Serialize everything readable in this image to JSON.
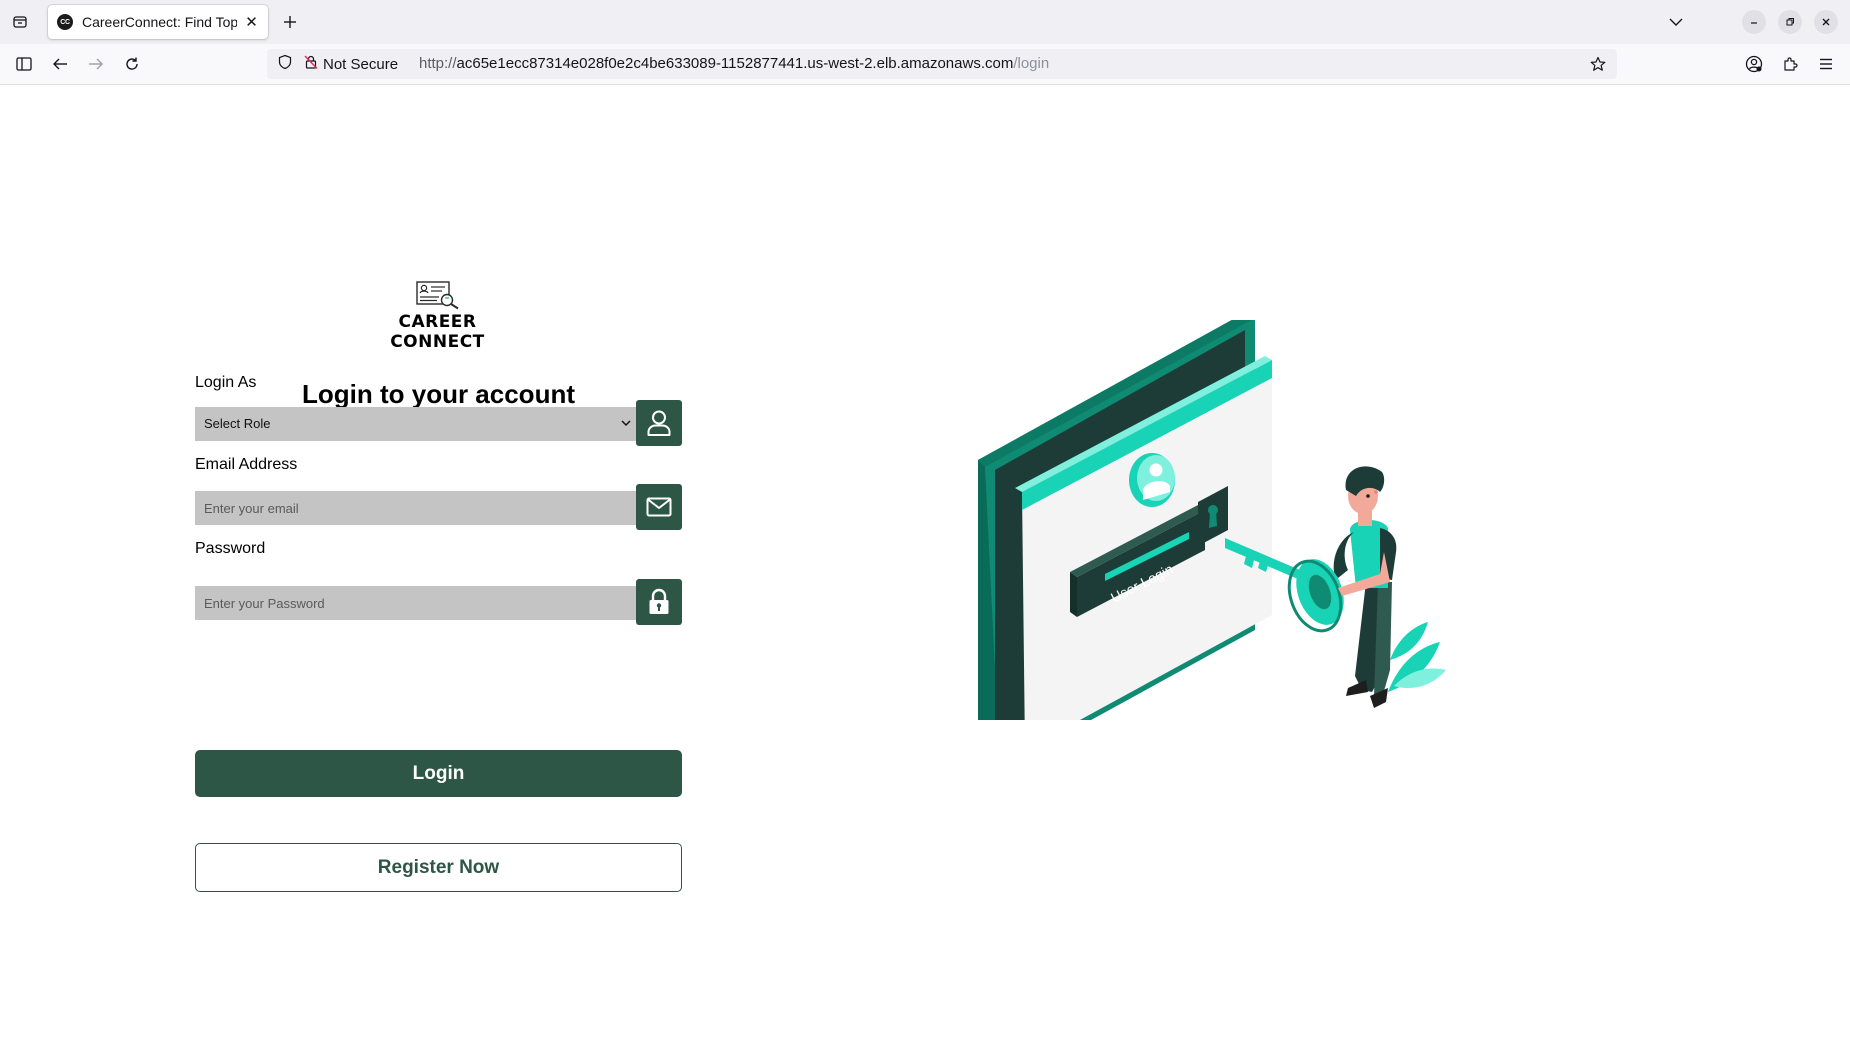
{
  "browser": {
    "tab": {
      "favicon_text": "CC",
      "title": "CareerConnect: Find Top"
    },
    "security_label": "Not Secure",
    "url": {
      "scheme": "http://",
      "host": "ac65e1ecc87314e028f0e2c4be633089-1152877441.us-west-2.elb.amazonaws.com",
      "path": "/login"
    },
    "icons": [
      "tab-list-icon",
      "new-tab-icon",
      "list-all-tabs-icon",
      "minimize-icon",
      "restore-icon",
      "close-window-icon",
      "sidebar-icon",
      "back-icon",
      "forward-icon",
      "reload-icon",
      "shield-icon",
      "insecure-lock-icon",
      "bookmark-star-icon",
      "account-icon",
      "extensions-icon",
      "menu-icon"
    ]
  },
  "brand": {
    "name": "CAREER CONNECT"
  },
  "form": {
    "title": "Login to your account",
    "role": {
      "label": "Login As",
      "selected": "Select Role"
    },
    "email": {
      "label": "Email Address",
      "placeholder": "Enter your email"
    },
    "password": {
      "label": "Password",
      "placeholder": "Enter your Password"
    },
    "login_button": "Login",
    "register_button": "Register Now"
  },
  "illustration": {
    "screen_text": "User Login"
  },
  "colors": {
    "primary": "#2e5646",
    "input_bg": "#c4c4c4",
    "accent_teal": "#19d3b6",
    "dark_teal": "#0f8b73"
  }
}
